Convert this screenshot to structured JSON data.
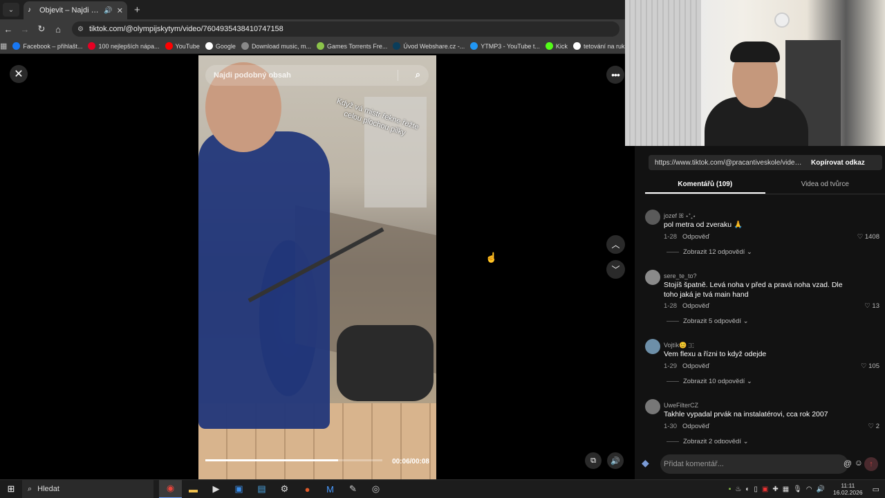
{
  "browser": {
    "tab_title": "Objevit – Najdi svoje oblíbe...",
    "url": "tiktok.com/@olympijskytym/video/7604935438410747158",
    "bookmarks": [
      {
        "label": "Facebook – přihlašt...",
        "color": "#1877f2",
        "icon": "facebook-icon"
      },
      {
        "label": "100 nejlepších nápa...",
        "color": "#e60023",
        "icon": "pinterest-icon"
      },
      {
        "label": "YouTube",
        "color": "#ff0000",
        "icon": "youtube-icon"
      },
      {
        "label": "Google",
        "color": "#ffffff",
        "icon": "google-icon"
      },
      {
        "label": "Download music, m...",
        "color": "#888888",
        "icon": "download-icon"
      },
      {
        "label": "Games Torrents Fre...",
        "color": "#8bc34a",
        "icon": "game-icon"
      },
      {
        "label": "Úvod Webshare.cz -...",
        "color": "#0b3d5a",
        "icon": "webshare-icon"
      },
      {
        "label": "YTMP3 - YouTube t...",
        "color": "#2196f3",
        "icon": "ytmp3-icon"
      },
      {
        "label": "Kick",
        "color": "#53fc18",
        "icon": "kick-icon"
      },
      {
        "label": "tetování na ruku mu...",
        "color": "#ffffff",
        "icon": "google-icon"
      }
    ]
  },
  "video": {
    "search_placeholder": "Najdi podobný obsah",
    "overlay_text": "Když vá mistr řekne řežte celou plochou pilky",
    "timecode": "00:06/00:08",
    "progress": 0.75
  },
  "panel": {
    "share_url": "https://www.tiktok.com/@pracantiveskole/video...",
    "copy_label": "Kopírovat odkaz",
    "tab_comments": "Komentářů (109)",
    "tab_creator": "Videa od tvůrce",
    "comments": [
      {
        "user": "jozef ꕤ ⋆⁺₊⋆",
        "text": "pol metra od zveraku 🙏",
        "date": "1-28",
        "reply": "Odpověď",
        "likes": "1408",
        "more": "Zobrazit 12 odpovědí",
        "avatar": "#5a5a5a"
      },
      {
        "user": "sere_te_to?",
        "text": "Stojíš špatně. Levá noha v před a pravá noha vzad. Dle toho jaká je tvá main hand",
        "date": "1-28",
        "reply": "Odpověď",
        "likes": "13",
        "more": "Zobrazit 5 odpovědí",
        "avatar": "#8a8a8a"
      },
      {
        "user": "Vojtík😊 🇮",
        "text": "Vem flexu a řízni to když odejde",
        "date": "1-29",
        "reply": "Odpověď",
        "likes": "105",
        "more": "Zobrazit 10 odpovědí",
        "avatar": "#6d8fa8"
      },
      {
        "user": "UweFilterCZ",
        "text": "Takhle vypadal prvák na instalatérovi, cca rok 2007",
        "date": "1-30",
        "reply": "Odpověď",
        "likes": "2",
        "more": "Zobrazit 2 odpovědí",
        "avatar": "#777777"
      }
    ],
    "composer_placeholder": "Přidat komentář..."
  },
  "taskbar": {
    "search_label": "Hledat",
    "time": "11:11",
    "date": "16.02.2026"
  }
}
